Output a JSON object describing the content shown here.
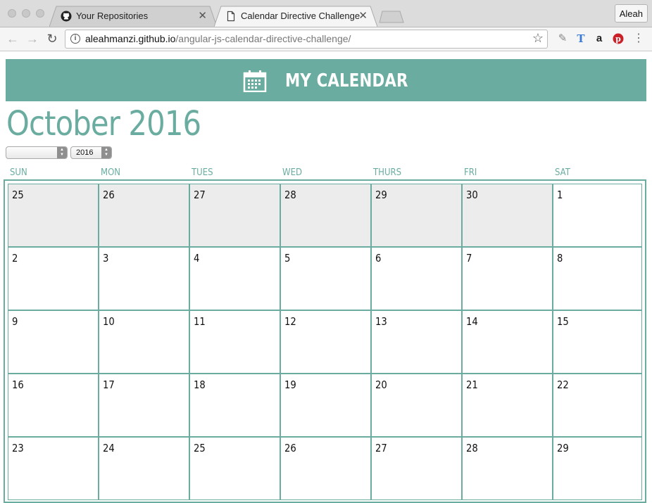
{
  "browser": {
    "tabs": [
      {
        "title": "Your Repositories",
        "icon": "github-icon",
        "active": false
      },
      {
        "title": "Calendar Directive Challenge",
        "icon": "document-icon",
        "active": true
      }
    ],
    "profile": "Aleah",
    "url": {
      "host": "aleahmanzi.github.io",
      "path": "/angular-js-calendar-directive-challenge/"
    }
  },
  "header": {
    "title": "MY CALENDAR",
    "icon": "calendar-icon",
    "color": "#6aada0"
  },
  "calendar": {
    "month_title": "October 2016",
    "month_select": "",
    "year_select": "2016",
    "weekdays": [
      "SUN",
      "MON",
      "TUES",
      "WED",
      "THURS",
      "FRI",
      "SAT"
    ],
    "weeks": [
      [
        {
          "day": "25",
          "other": true
        },
        {
          "day": "26",
          "other": true
        },
        {
          "day": "27",
          "other": true
        },
        {
          "day": "28",
          "other": true
        },
        {
          "day": "29",
          "other": true
        },
        {
          "day": "30",
          "other": true
        },
        {
          "day": "1",
          "other": false
        }
      ],
      [
        {
          "day": "2",
          "other": false
        },
        {
          "day": "3",
          "other": false
        },
        {
          "day": "4",
          "other": false
        },
        {
          "day": "5",
          "other": false
        },
        {
          "day": "6",
          "other": false
        },
        {
          "day": "7",
          "other": false
        },
        {
          "day": "8",
          "other": false
        }
      ],
      [
        {
          "day": "9",
          "other": false
        },
        {
          "day": "10",
          "other": false
        },
        {
          "day": "11",
          "other": false
        },
        {
          "day": "12",
          "other": false
        },
        {
          "day": "13",
          "other": false
        },
        {
          "day": "14",
          "other": false
        },
        {
          "day": "15",
          "other": false
        }
      ],
      [
        {
          "day": "16",
          "other": false
        },
        {
          "day": "17",
          "other": false
        },
        {
          "day": "18",
          "other": false
        },
        {
          "day": "19",
          "other": false
        },
        {
          "day": "20",
          "other": false
        },
        {
          "day": "21",
          "other": false
        },
        {
          "day": "22",
          "other": false
        }
      ],
      [
        {
          "day": "23",
          "other": false
        },
        {
          "day": "24",
          "other": false
        },
        {
          "day": "25",
          "other": false
        },
        {
          "day": "26",
          "other": false
        },
        {
          "day": "27",
          "other": false
        },
        {
          "day": "28",
          "other": false
        },
        {
          "day": "29",
          "other": false
        }
      ]
    ]
  }
}
